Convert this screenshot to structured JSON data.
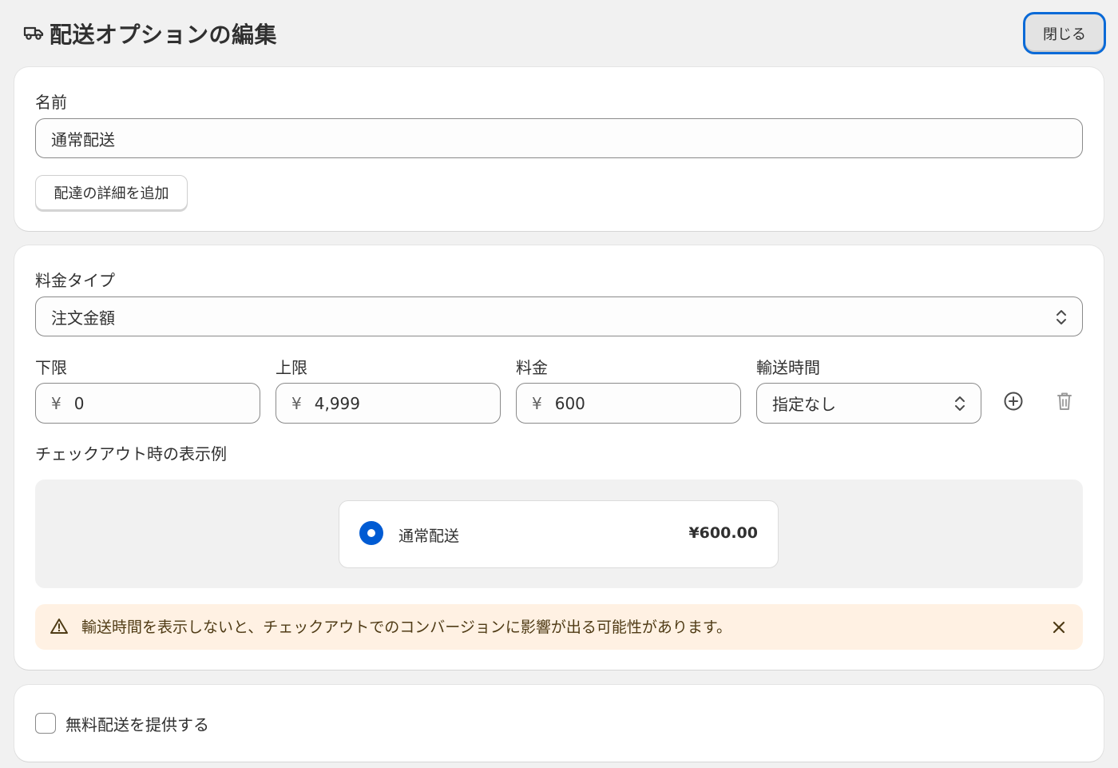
{
  "header": {
    "title": "配送オプションの編集",
    "icon": "truck-icon",
    "close_label": "閉じる"
  },
  "name_section": {
    "label": "名前",
    "value": "通常配送",
    "add_details_label": "配達の詳細を追加"
  },
  "rate_section": {
    "rate_type_label": "料金タイプ",
    "rate_type_value": "注文金額",
    "min_label": "下限",
    "min_value": "0",
    "max_label": "上限",
    "max_value": "4,999",
    "price_label": "料金",
    "price_value": "600",
    "currency_prefix": "¥",
    "transit_label": "輸送時間",
    "transit_value": "指定なし",
    "preview_label": "チェックアウト時の表示例",
    "preview_name": "通常配送",
    "preview_price": "¥600.00",
    "warning_text": "輸送時間を表示しないと、チェックアウトでのコンバージョンに影響が出る可能性があります。"
  },
  "free_shipping": {
    "label": "無料配送を提供する",
    "checked": false
  },
  "colors": {
    "accent": "#005bd3",
    "focus_ring": "#0a6ad7",
    "warning_bg": "#fff1e3"
  }
}
